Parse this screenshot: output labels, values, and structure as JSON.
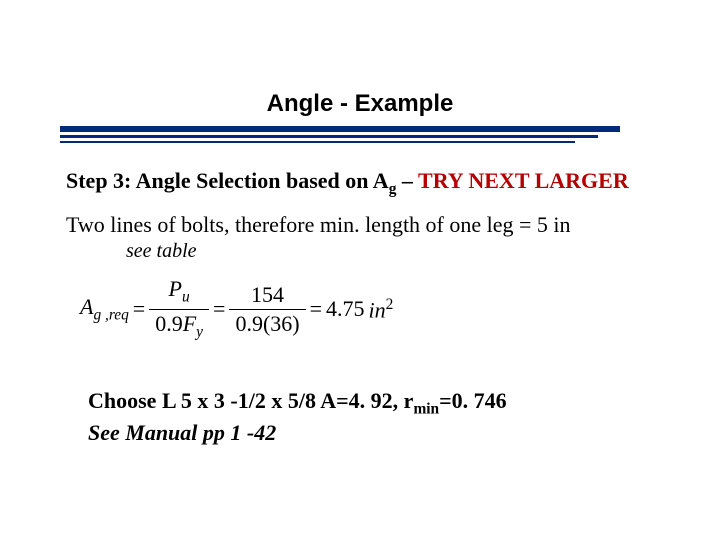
{
  "title": "Angle - Example",
  "step": {
    "prefix": "Step 3: Angle Selection based on A",
    "sub": "g",
    "dash": "– ",
    "try": "TRY NEXT LARGER"
  },
  "two_lines": "Two lines of bolts, therefore min. length of one leg = 5 in",
  "see_table": "see table",
  "formula": {
    "lhs_A": "A",
    "lhs_sub": "g ,req",
    "eq": "=",
    "frac1_num_P": "P",
    "frac1_num_sub": "u",
    "frac1_den": "0.9",
    "frac1_den_F": "F",
    "frac1_den_sub": "y",
    "frac2_num": "154",
    "frac2_den": "0.9(36)",
    "rhs_val": "4.75",
    "rhs_unit": "in",
    "rhs_sup": "2"
  },
  "choose": {
    "line1_a": "Choose L 5 x 3 -1/2 x 5/8   A=4. 92, r",
    "line1_sub": "min",
    "line1_b": "=0. 746",
    "line2": "See Manual pp 1 -42"
  }
}
